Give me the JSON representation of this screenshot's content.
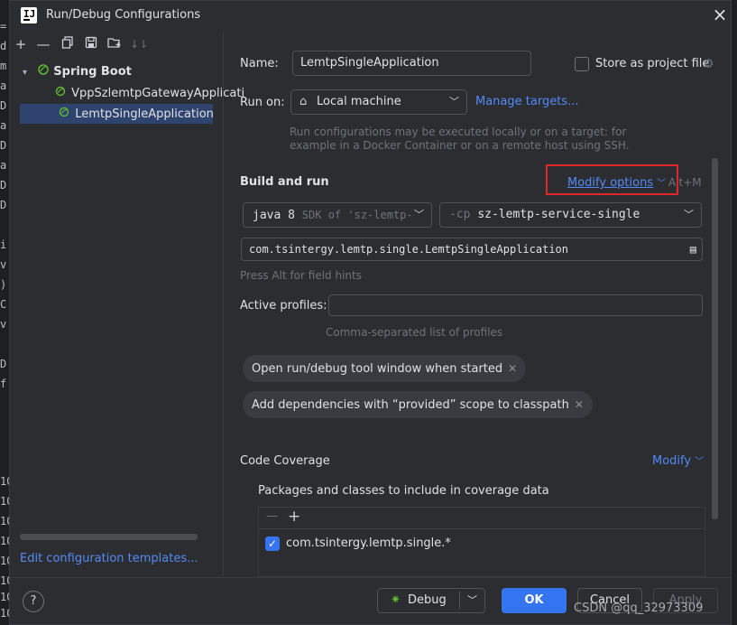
{
  "window": {
    "title": "Run/Debug Configurations",
    "close_icon": "close-icon"
  },
  "background_gutter": [
    "=",
    "d",
    "m",
    "a",
    "D",
    "a",
    "D",
    "a",
    "D",
    "D",
    "i",
    "v",
    ")",
    "C",
    "v",
    "D",
    "f",
    "10",
    "10",
    "10",
    "10",
    "10",
    "10",
    "10",
    "10",
    "13"
  ],
  "toolbar": {
    "icons": [
      "add-icon",
      "remove-icon",
      "copy-icon",
      "save-icon",
      "new-folder-icon",
      "sort-icon"
    ]
  },
  "tree": {
    "group": "Spring Boot",
    "items": [
      "VppSzlemtpGatewayApplicati",
      "LemtpSingleApplication"
    ],
    "selected_index": 1
  },
  "edit_templates_link": "Edit configuration templates...",
  "form": {
    "name_label": "Name:",
    "name_value": "LemtpSingleApplication",
    "store_label": "Store as project file",
    "run_on_label": "Run on:",
    "run_on_value": "Local machine",
    "manage_targets": "Manage targets...",
    "run_on_hint_1": "Run configurations may be executed locally or on a target: for",
    "run_on_hint_2": "example in a Docker Container or on a remote host using SSH.",
    "build_run_title": "Build and run",
    "modify_options": "Modify options",
    "modify_shortcut": "Alt+M",
    "jdk_main": "java 8",
    "jdk_sub": "SDK of 'sz-lemtp-s",
    "cp_prefix": "-cp",
    "cp_value": "sz-lemtp-service-single",
    "main_class": "com.tsintergy.lemtp.single.LemtpSingleApplication",
    "field_hint": "Press Alt for field hints",
    "profiles_label": "Active profiles:",
    "profiles_value": "",
    "profiles_hint": "Comma-separated list of profiles",
    "chips": [
      "Open run/debug tool window when started",
      "Add dependencies with “provided” scope to classpath"
    ],
    "coverage_title": "Code Coverage",
    "coverage_modify": "Modify",
    "coverage_packages_label": "Packages and classes to include in coverage data",
    "coverage_items": [
      "com.tsintergy.lemtp.single.*"
    ]
  },
  "footer": {
    "help": "?",
    "debug": "Debug",
    "ok": "OK",
    "cancel": "Cancel",
    "apply": "Apply"
  },
  "watermark": "CSDN @qq_32973309",
  "colors": {
    "accent": "#3574f0",
    "link": "#548af7",
    "highlight_box": "#e0252b",
    "selection": "#2e436e"
  }
}
